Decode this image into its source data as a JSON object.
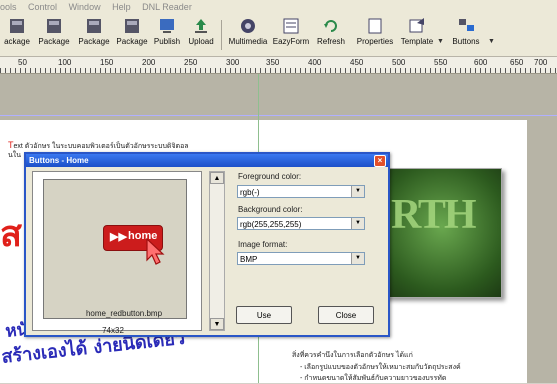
{
  "menubar": [
    "ools",
    "Control",
    "Window",
    "Help",
    "DNL Reader"
  ],
  "toolbar": {
    "buttons": [
      {
        "label": "ackage",
        "icon": "package-icon"
      },
      {
        "label": "Package",
        "icon": "package-icon"
      },
      {
        "label": "Package",
        "icon": "package-icon"
      },
      {
        "label": "Package",
        "icon": "package-icon"
      },
      {
        "label": "Publish",
        "icon": "publish-icon"
      },
      {
        "label": "Upload",
        "icon": "upload-icon"
      },
      {
        "label": "Multimedia",
        "icon": "multimedia-icon"
      },
      {
        "label": "EazyForm",
        "icon": "form-icon"
      },
      {
        "label": "Refresh",
        "icon": "refresh-icon"
      },
      {
        "label": "Properties",
        "icon": "properties-icon"
      },
      {
        "label": "Template",
        "icon": "template-icon"
      },
      {
        "label": "Buttons",
        "icon": "buttons-icon"
      }
    ]
  },
  "ruler": [
    "50",
    "100",
    "150",
    "200",
    "250",
    "300",
    "350",
    "400",
    "450",
    "500",
    "550",
    "600",
    "650",
    "700"
  ],
  "document": {
    "line1": "ext ตัวอักษร ในระบบคอมพิวเตอร์เป็นตัวอักษรระบบดิจิตอล",
    "line1_prefix": "T",
    "line2": "นใน",
    "big_red_letter": "ส",
    "thai_heading_1": "หนังสือสู่ใจ",
    "thai_heading_2": "สร้างเองได้ ง่ายนิดเดียว",
    "right_text_1": "สิ่งที่ควรคำนึงในการเลือกตัวอักษร ได้แก่",
    "right_text_2": "- เลือกรูปแบบของตัวอักษรให้เหมาะสมกับวัตถุประสงค์",
    "right_text_3": "- กำหนดขนาดให้สัมพันธ์กับความยาวของบรรทัด",
    "image_word": "RTH"
  },
  "dialog": {
    "title": "Buttons - Home",
    "preview": {
      "button_label": "home",
      "filename": "home_redbutton.bmp",
      "dimensions": "74x32"
    },
    "foreground_label": "Foreground color:",
    "foreground_value": "rgb(-)",
    "background_label": "Background color:",
    "background_value": "rgb(255,255,255)",
    "format_label": "Image format:",
    "format_value": "BMP",
    "use_label": "Use",
    "close_label": "Close"
  },
  "colors": {
    "dialog_border": "#2a56c7",
    "button_red": "#cc1c1c",
    "thai_text": "#2b2bb8",
    "big_red": "#e0201a"
  }
}
